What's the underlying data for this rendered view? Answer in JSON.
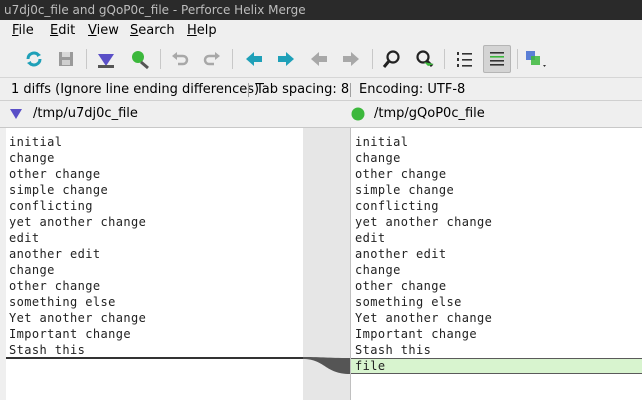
{
  "window": {
    "title": "u7dj0c_file and gQoP0c_file - Perforce Helix Merge"
  },
  "menu": {
    "file": {
      "u": "F",
      "rest": "ile"
    },
    "edit": {
      "u": "E",
      "rest": "dit"
    },
    "view": {
      "u": "V",
      "rest": "iew"
    },
    "search": {
      "u": "S",
      "rest": "earch"
    },
    "help": {
      "u": "H",
      "rest": "elp"
    }
  },
  "toolbar": {
    "icons": [
      "refresh-icon",
      "save-icon",
      "left-diff-icon",
      "right-diff-icon",
      "undo-icon",
      "redo-icon",
      "next-diff-icon",
      "prev-diff-icon",
      "prev-conflict-icon",
      "next-conflict-icon",
      "find-icon",
      "find-diff-icon",
      "line-numbers-icon",
      "show-whitespace-icon",
      "layout-icon"
    ],
    "accent": "#1fa0b8"
  },
  "status": {
    "diffs": "1 diffs (Ignore line ending differences)",
    "tab_spacing": "Tab spacing: 8",
    "encoding": "Encoding: UTF-8"
  },
  "files": {
    "left": {
      "path": "/tmp/u7dj0c_file",
      "marker_color": "#5a4fc7"
    },
    "right": {
      "path": "/tmp/gQoP0c_file",
      "marker_color": "#3cb83c"
    }
  },
  "left_lines": [
    "initial",
    "change",
    "other change",
    "simple change",
    "conflicting",
    "yet another change",
    "edit",
    "another edit",
    "change",
    "other change",
    "something else",
    "Yet another change",
    "Important change",
    "Stash this"
  ],
  "right_lines": [
    "initial",
    "change",
    "other change",
    "simple change",
    "conflicting",
    "yet another change",
    "edit",
    "another edit",
    "change",
    "other change",
    "something else",
    "Yet another change",
    "Important change",
    "Stash this",
    "file"
  ],
  "diff_color": "#d8f4cf"
}
